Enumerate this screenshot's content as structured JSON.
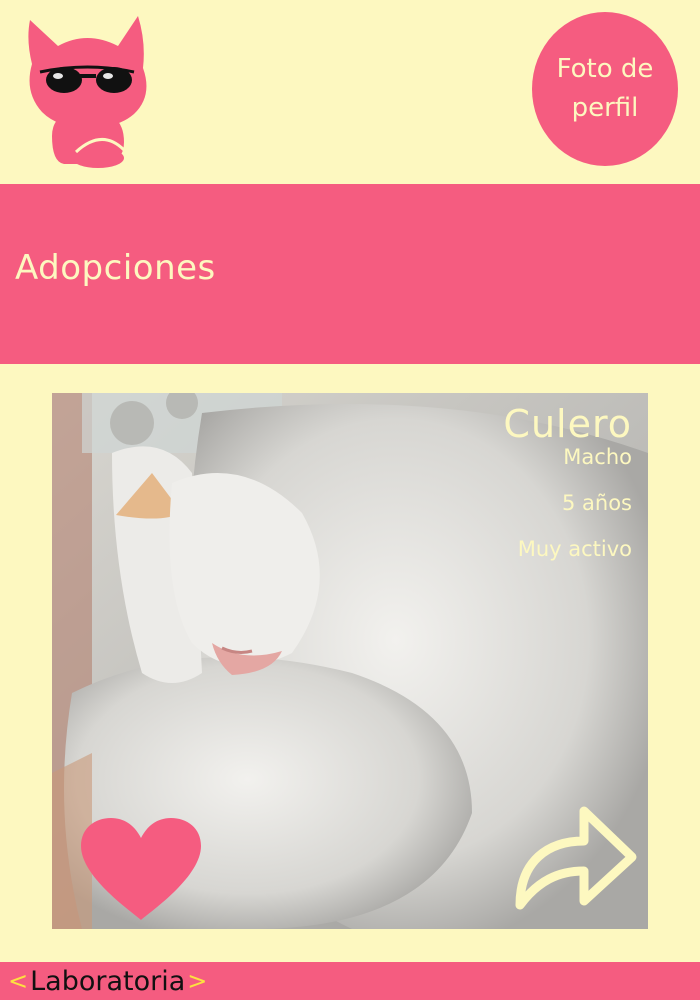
{
  "header": {
    "logo_icon": "cat-with-sunglasses-icon",
    "profile_button_label": "Foto de perfil"
  },
  "page_title": "Adopciones",
  "pet": {
    "name": "Culero",
    "sex": "Macho",
    "age": "5 años",
    "temperament": "Muy activo",
    "photo_icon": "sleeping-cat-photo"
  },
  "actions": {
    "like_icon": "heart-icon",
    "share_icon": "share-arrow-icon"
  },
  "footer": {
    "brand": "Laboratoria",
    "bracket_left": "<",
    "bracket_right": ">"
  },
  "colors": {
    "background": "#fdf8c0",
    "primary_pink": "#f55c80",
    "cream_text": "#fdf8c0",
    "logo_bracket": "#fde140"
  }
}
